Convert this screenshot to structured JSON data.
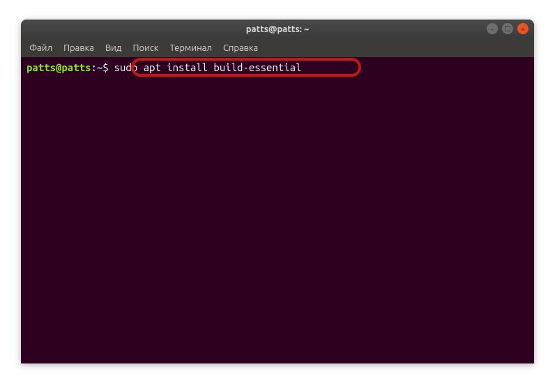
{
  "window": {
    "title": "patts@patts: ~"
  },
  "menu": {
    "file": "Файл",
    "edit": "Правка",
    "view": "Вид",
    "search": "Поиск",
    "terminal": "Терминал",
    "help": "Справка"
  },
  "prompt": {
    "user_host": "patts@patts",
    "colon": ":",
    "path": "~",
    "dollar": "$"
  },
  "command": "sudo apt install build-essential",
  "controls": {
    "minimize": "−",
    "maximize": "□",
    "close": "×"
  }
}
